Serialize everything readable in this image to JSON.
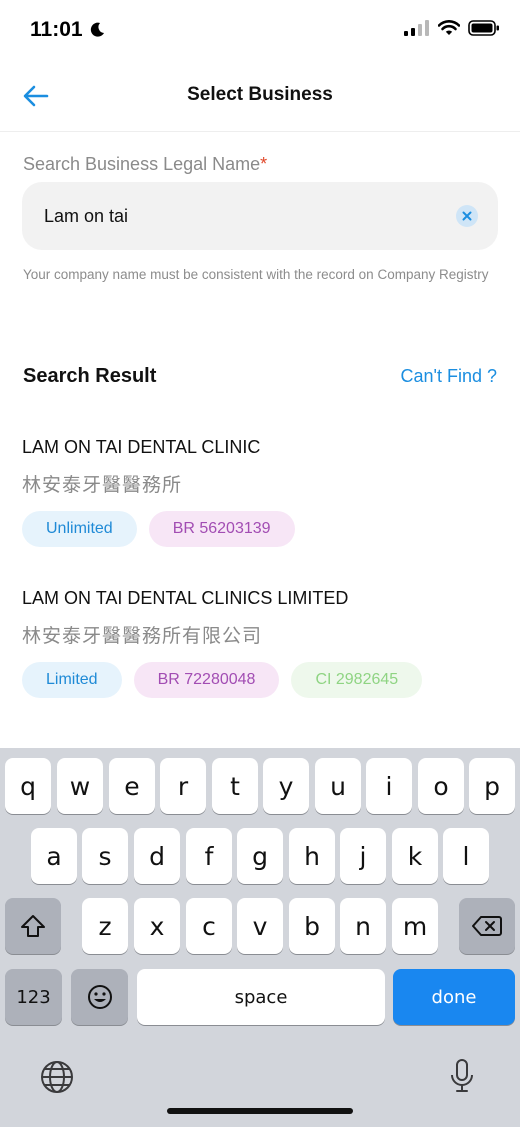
{
  "status_bar": {
    "time": "11:01"
  },
  "nav": {
    "title": "Select Business"
  },
  "search": {
    "label": "Search Business Legal Name",
    "required_mark": "*",
    "value": "Lam on tai",
    "hint": "Your company name must be consistent with the record on Company Registry"
  },
  "results_section": {
    "title": "Search Result",
    "cant_find": "Can't Find ?"
  },
  "results": [
    {
      "name_en": "LAM ON TAI DENTAL CLINIC",
      "name_zh": "林安泰牙醫醫務所",
      "tags": [
        {
          "label": "Unlimited",
          "color": "#1f8ad6"
        },
        {
          "label": "BR 56203139",
          "color": "#a24db3"
        }
      ]
    },
    {
      "name_en": "LAM ON TAI DENTAL CLINICS LIMITED",
      "name_zh": "林安泰牙醫醫務所有限公司",
      "tags": [
        {
          "label": "Limited",
          "color": "#1f8ad6"
        },
        {
          "label": "BR 72280048",
          "color": "#a24db3"
        },
        {
          "label": "CI 2982645",
          "color": "#8fd483"
        }
      ]
    }
  ],
  "keyboard": {
    "row1": [
      "q",
      "w",
      "e",
      "r",
      "t",
      "y",
      "u",
      "i",
      "o",
      "p"
    ],
    "row2": [
      "a",
      "s",
      "d",
      "f",
      "g",
      "h",
      "j",
      "k",
      "l"
    ],
    "row3": [
      "z",
      "x",
      "c",
      "v",
      "b",
      "n",
      "m"
    ],
    "numbers_key": "123",
    "space_key": "space",
    "done_key": "done"
  },
  "icons": {
    "back": "arrow-left-icon",
    "clear": "close-circle-icon",
    "shift": "shift-icon",
    "delete": "backspace-icon",
    "emoji": "emoji-icon",
    "globe": "globe-icon",
    "mic": "microphone-icon"
  },
  "colors": {
    "accent": "#1b8ee0",
    "required": "#e0482a",
    "done_key": "#1987f0"
  }
}
